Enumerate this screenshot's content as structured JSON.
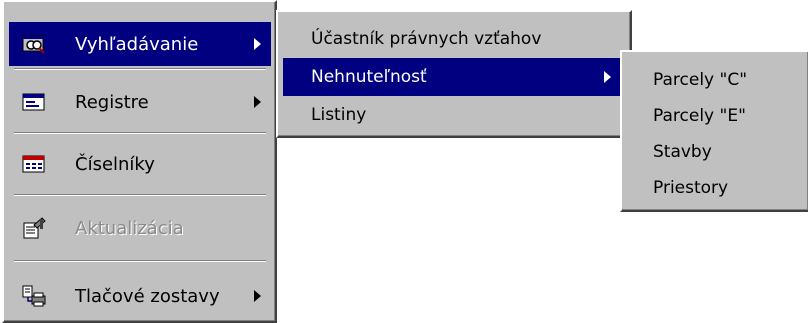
{
  "main_menu": {
    "items": [
      {
        "label": "Vyhľadávanie",
        "icon": "search-binoculars-icon",
        "has_submenu": true,
        "selected": true
      },
      {
        "label": "Registre",
        "icon": "register-window-icon",
        "has_submenu": true
      },
      {
        "label": "Číselníky",
        "icon": "codelist-table-icon",
        "has_submenu": false
      },
      {
        "label": "Aktualizácia",
        "icon": "update-document-icon",
        "has_submenu": false,
        "disabled": true
      },
      {
        "label": "Tlačové zostavy",
        "icon": "print-reports-icon",
        "has_submenu": true
      }
    ]
  },
  "submenu_search": {
    "items": [
      {
        "label": "Účastník právnych vzťahov"
      },
      {
        "label": "Nehnuteľnosť",
        "has_submenu": true,
        "selected": true
      },
      {
        "label": "Listiny"
      }
    ]
  },
  "submenu_property": {
    "items": [
      {
        "label": "Parcely \"C\""
      },
      {
        "label": "Parcely \"E\""
      },
      {
        "label": "Stavby"
      },
      {
        "label": "Priestory"
      }
    ]
  },
  "colors": {
    "menu_bg": "#c0c0c0",
    "highlight": "#000080",
    "disabled_text": "#8a8a8a"
  }
}
